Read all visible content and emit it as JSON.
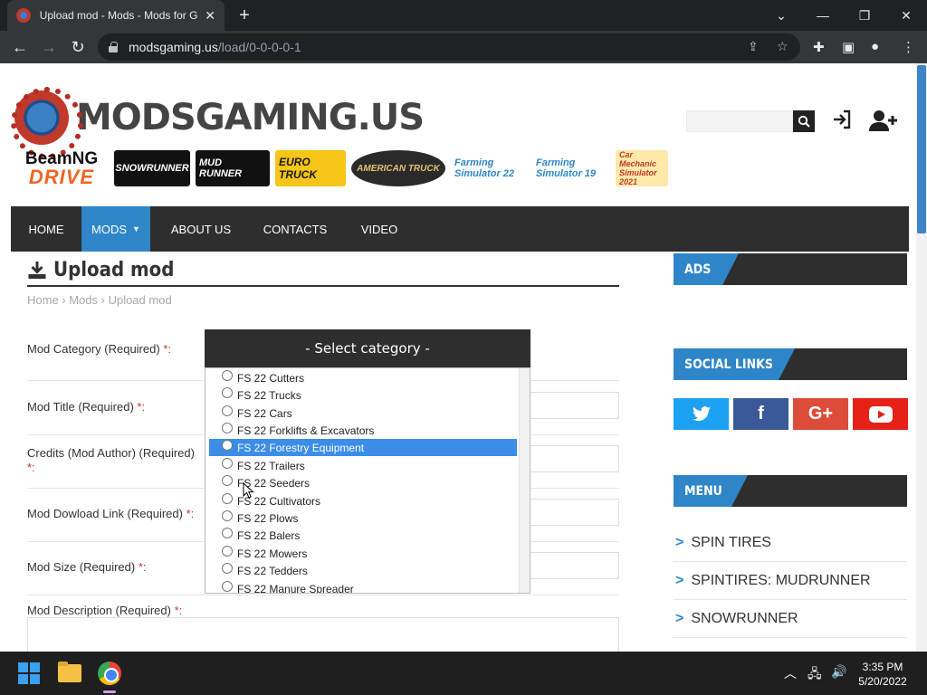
{
  "browser": {
    "tab_title": "Upload mod - Mods - Mods for G",
    "url_host": "modsgaming.us",
    "url_path": "/load/0-0-0-0-1"
  },
  "site": {
    "logo_text": "MODSGAMING.US",
    "brand_logos": [
      "BeamNG",
      "DRIVE",
      "SNOWRUNNER",
      "MUD RUNNER",
      "EURO TRUCK",
      "AMERICAN TRUCK",
      "Farming Simulator 22",
      "Farming Simulator 19",
      "Car Mechanic Simulator 2021"
    ],
    "nav": [
      {
        "label": "HOME"
      },
      {
        "label": "MODS"
      },
      {
        "label": "ABOUT US"
      },
      {
        "label": "CONTACTS"
      },
      {
        "label": "VIDEO"
      }
    ]
  },
  "main": {
    "title": "Upload mod",
    "breadcrumb": "Home › Mods › Upload mod",
    "form": {
      "category_label": "Mod Category (Required)",
      "title_label": "Mod Title (Required)",
      "credits_label": "Credits (Mod Author) (Required)",
      "link_label": "Mod Dowload Link (Required)",
      "size_label": "Mod Size (Required)",
      "description_label": "Mod Description (Required)",
      "required_mark": "*:",
      "select_placeholder": "- Select category -",
      "options": [
        "FS 22 Cutters",
        "FS 22 Trucks",
        "FS 22 Cars",
        "FS 22 Forklifts & Excavators",
        "FS 22 Forestry Equipment",
        "FS 22 Trailers",
        "FS 22 Seeders",
        "FS 22 Cultivators",
        "FS 22 Plows",
        "FS 22 Balers",
        "FS 22 Mowers",
        "FS 22 Tedders",
        "FS 22 Manure Spreader"
      ],
      "highlighted_option": "FS 22 Forestry Equipment"
    }
  },
  "sidebar": {
    "ads_title": "ADS",
    "social_title": "SOCIAL LINKS",
    "social": [
      {
        "icon": "twitter-icon",
        "glyph": "🐦",
        "color": "#1da1f2"
      },
      {
        "icon": "facebook-icon",
        "glyph": "f",
        "color": "#3b5998"
      },
      {
        "icon": "google-plus-icon",
        "glyph": "G+",
        "color": "#dd4b39"
      },
      {
        "icon": "youtube-icon",
        "glyph": "▶",
        "color": "#e62117"
      }
    ],
    "menu_title": "MENU",
    "menu": [
      "SPIN TIRES",
      "SPINTIRES: MUDRUNNER",
      "SNOWRUNNER"
    ]
  },
  "taskbar": {
    "time": "3:35 PM",
    "date": "5/20/2022"
  },
  "colors": {
    "accent": "#2e86c9",
    "nav_bg": "#2e2e2e",
    "highlight": "#3b8de8"
  }
}
